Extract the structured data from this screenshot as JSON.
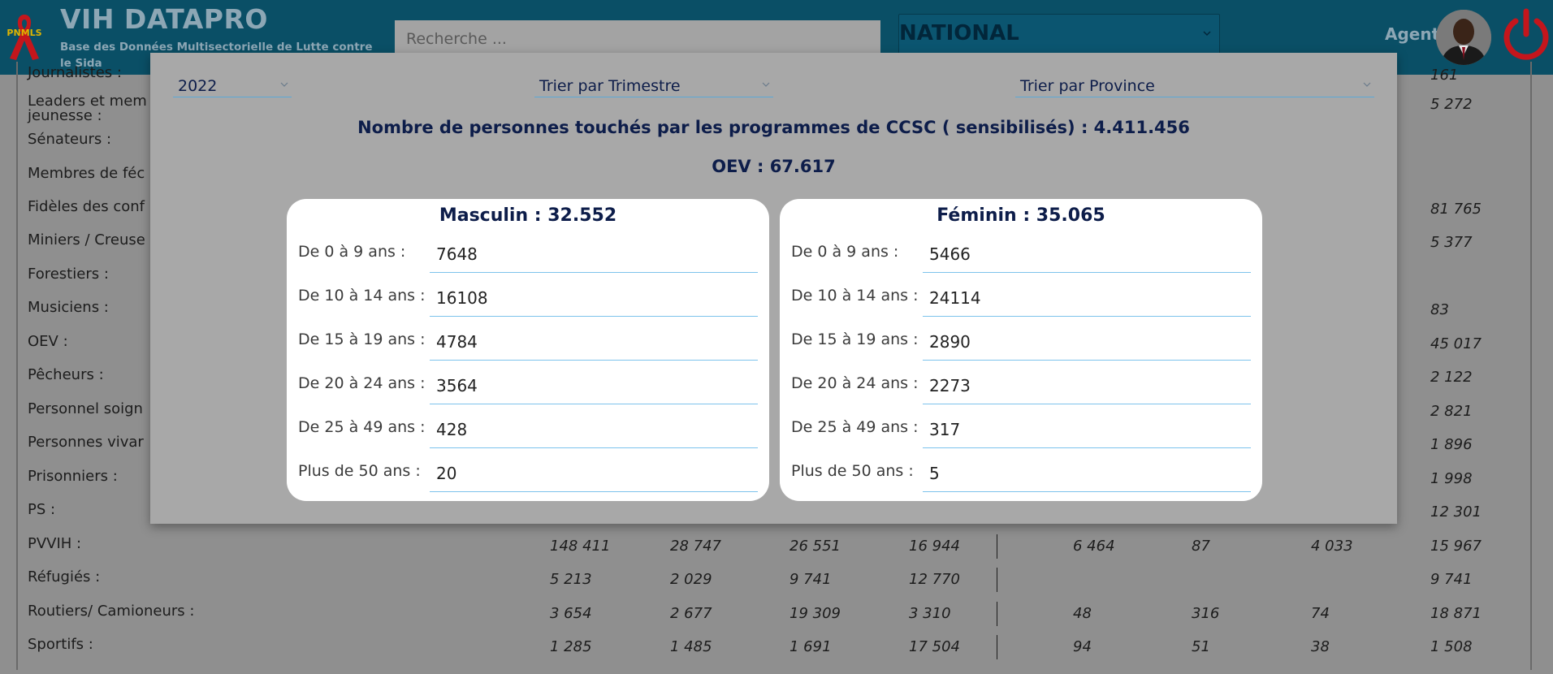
{
  "header": {
    "logo_text": "PNMLS",
    "title": "VIH DATAPRO",
    "subtitle": "Base des Données Multisectorielle de Lutte contre le Sida",
    "search_placeholder": "Recherche ...",
    "region": "NATIONAL",
    "agent_label": "Agent",
    "icons": [
      "red-ribbon-icon",
      "chevron-down-icon",
      "avatar",
      "power-icon"
    ],
    "colors": {
      "header_bg": "#0a4f66",
      "power_red": "#c4161c"
    }
  },
  "background_rows": [
    {
      "label": "Journalistes :",
      "values": [
        "",
        "",
        "",
        "",
        "",
        "",
        "",
        "161"
      ]
    },
    {
      "label": "Leaders et mem jeunesse :",
      "values": [
        "",
        "",
        "",
        "",
        "",
        "",
        "",
        "5 272"
      ]
    },
    {
      "label": "Sénateurs :",
      "values": [
        "",
        "",
        "",
        "",
        "",
        "",
        "",
        ""
      ]
    },
    {
      "label": "Membres de féc",
      "values": [
        "",
        "",
        "",
        "",
        "",
        "",
        "",
        ""
      ]
    },
    {
      "label": "Fidèles des conf",
      "values": [
        "",
        "",
        "",
        "",
        "",
        "",
        "",
        "81 765"
      ]
    },
    {
      "label": "Miniers / Creuse",
      "values": [
        "",
        "",
        "",
        "",
        "",
        "",
        "",
        "5 377"
      ]
    },
    {
      "label": "Forestiers :",
      "values": [
        "",
        "",
        "",
        "",
        "",
        "",
        "",
        ""
      ]
    },
    {
      "label": "Musiciens  :",
      "values": [
        "",
        "",
        "",
        "",
        "",
        "",
        "",
        "83"
      ]
    },
    {
      "label": "OEV :",
      "values": [
        "",
        "",
        "",
        "",
        "",
        "",
        "",
        "45 017"
      ]
    },
    {
      "label": "Pêcheurs :",
      "values": [
        "",
        "",
        "",
        "",
        "",
        "",
        "",
        "2 122"
      ]
    },
    {
      "label": "Personnel soign",
      "values": [
        "",
        "",
        "",
        "",
        "",
        "",
        "",
        "2 821"
      ]
    },
    {
      "label": "Personnes vivar",
      "values": [
        "",
        "",
        "",
        "",
        "",
        "",
        "",
        "1 896"
      ]
    },
    {
      "label": "Prisonniers :",
      "values": [
        "",
        "",
        "",
        "",
        "",
        "",
        "",
        "1 998"
      ]
    },
    {
      "label": "PS :",
      "values": [
        "",
        "",
        "",
        "",
        "",
        "",
        "",
        "12 301"
      ]
    },
    {
      "label": "PVVIH :",
      "values": [
        "148 411",
        "28 747",
        "26 551",
        "16 944",
        "6 464",
        "87",
        "4 033",
        "15 967"
      ]
    },
    {
      "label": "Réfugiés :",
      "values": [
        "5 213",
        "2 029",
        "9 741",
        "12 770",
        "",
        "",
        "",
        "9 741"
      ]
    },
    {
      "label": "Routiers/ Camioneurs :",
      "values": [
        "3 654",
        "2 677",
        "19 309",
        "3 310",
        "48",
        "316",
        "74",
        "18 871"
      ]
    },
    {
      "label": "Sportifs  :",
      "values": [
        "1 285",
        "1 485",
        "1 691",
        "17 504",
        "94",
        "51",
        "38",
        "1 508"
      ]
    }
  ],
  "modal": {
    "year": "2022",
    "trimestre_label": "Trier par Trimestre",
    "province_label": "Trier par Province",
    "ccsc_text": "Nombre de personnes touchés par les programmes de CCSC  ( sensibilisés) : 4.411.456",
    "oev_text": "OEV : 67.617",
    "masculin": {
      "title": "Masculin : 32.552",
      "rows": [
        {
          "label": "De 0 à 9 ans :",
          "value": "7648"
        },
        {
          "label": "De 10 à  14 ans :",
          "value": "16108"
        },
        {
          "label": "De 15 à  19 ans :",
          "value": "4784"
        },
        {
          "label": "De 20 à 24 ans :",
          "value": "3564"
        },
        {
          "label": "De 25 à 49 ans :",
          "value": "428"
        },
        {
          "label": "Plus de 50 ans :",
          "value": "20"
        }
      ]
    },
    "feminin": {
      "title": "Féminin : 35.065",
      "rows": [
        {
          "label": "De 0 à 9 ans :",
          "value": "5466"
        },
        {
          "label": "De 10 à  14 ans :",
          "value": "24114"
        },
        {
          "label": "De 15 à  19 ans :",
          "value": "2890"
        },
        {
          "label": "De 20 à 24 ans :",
          "value": "2273"
        },
        {
          "label": "De 25 à 49 ans :",
          "value": "317"
        },
        {
          "label": "Plus de 50 ans :",
          "value": "5"
        }
      ]
    }
  }
}
